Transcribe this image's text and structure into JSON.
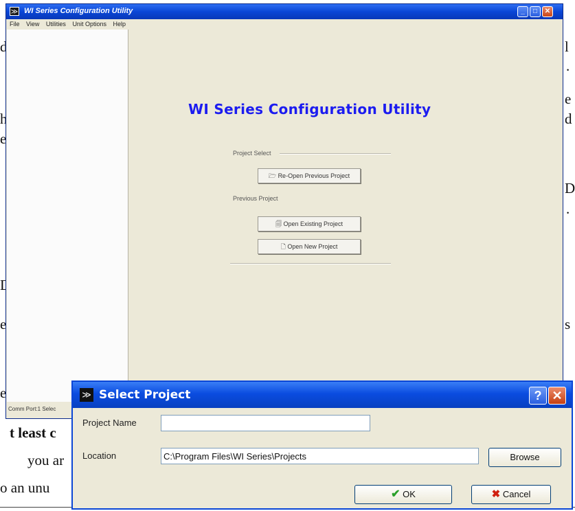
{
  "document": {
    "fragments": [
      {
        "text": "d"
      },
      {
        "text": "l"
      },
      {
        "text": "."
      },
      {
        "text": "e"
      },
      {
        "text": "h"
      },
      {
        "text": "d"
      },
      {
        "text": "e"
      },
      {
        "text": "D"
      },
      {
        "text": "."
      },
      {
        "text": "D"
      },
      {
        "text": "e"
      },
      {
        "text": "s"
      },
      {
        "text": "e"
      },
      {
        "text": "t least c"
      },
      {
        "text": "you ar"
      },
      {
        "text": "o an unu"
      }
    ]
  },
  "window": {
    "title": "WI Series Configuration Utility",
    "menu": [
      "File",
      "View",
      "Utilities",
      "Unit Options",
      "Help"
    ],
    "status": "Comm Port:1  Selec"
  },
  "main": {
    "title": "WI Series Configuration Utility",
    "project_select_label": "Project Select",
    "reopen_button": "Re-Open Previous Project",
    "previous_project_label": "Previous Project",
    "open_existing_button": "Open Existing Project",
    "open_new_button": "Open New Project"
  },
  "dialog": {
    "title": "Select Project",
    "project_name_label": "Project Name",
    "project_name_value": "",
    "location_label": "Location",
    "location_value": "C:\\Program Files\\WI Series\\Projects",
    "browse_button": "Browse",
    "ok_button": "OK",
    "cancel_button": "Cancel"
  },
  "colors": {
    "title_blue": "#0a46d6",
    "app_title": "#1c1cf0",
    "ok_check": "#2aa02a",
    "cancel_x": "#d02010"
  }
}
